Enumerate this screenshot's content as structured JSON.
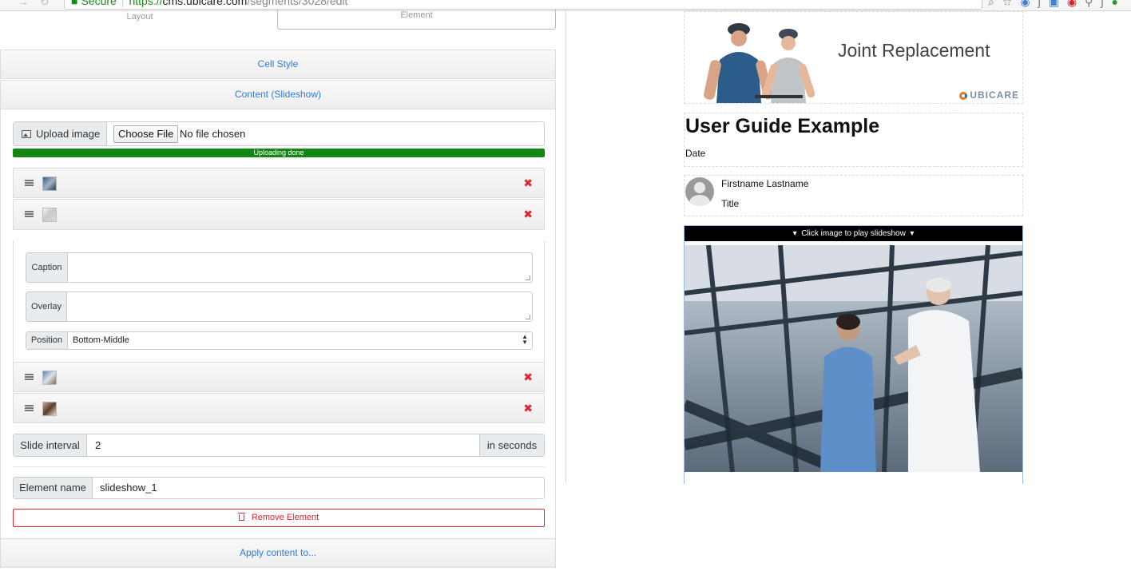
{
  "browser": {
    "secure_label": "Secure",
    "url_scheme": "https://",
    "url_host": "cms.ubicare.com",
    "url_path": "/segments/3028/edit"
  },
  "editor": {
    "tabs": {
      "layout": "Layout",
      "element": "Element"
    },
    "cell_style": "Cell Style",
    "content_title": "Content (Slideshow)",
    "upload": {
      "button_label": "Upload image",
      "choose_label": "Choose File",
      "no_file": "No file chosen",
      "progress_text": "Uploading done",
      "progress_percent": 100
    },
    "slides": [
      {
        "thumb": "hospital-corridor-thumb"
      },
      {
        "thumb": "nurse-thumb"
      },
      {
        "thumb": "doctor-thumb"
      },
      {
        "thumb": "patient-thumb"
      }
    ],
    "detail": {
      "caption_label": "Caption",
      "overlay_label": "Overlay",
      "position_label": "Position",
      "position_value": "Bottom-Middle"
    },
    "interval": {
      "label": "Slide interval",
      "value": "2",
      "suffix": "in seconds"
    },
    "element_name": {
      "label": "Element name",
      "value": "slideshow_1"
    },
    "remove_label": "Remove Element",
    "apply_label": "Apply content to..."
  },
  "preview": {
    "banner_title": "Joint Replacement",
    "logo_text": "UBICARE",
    "guide_title": "User Guide Example",
    "date": "Date",
    "author_name": "Firstname Lastname",
    "author_title": "Title",
    "slideshow_bar": "Click image to play slideshow"
  },
  "colors": {
    "link_blue": "#2f7bd6",
    "danger_red": "#d9262f",
    "progress_green": "#138613",
    "logo_orange": "#e8791b"
  }
}
